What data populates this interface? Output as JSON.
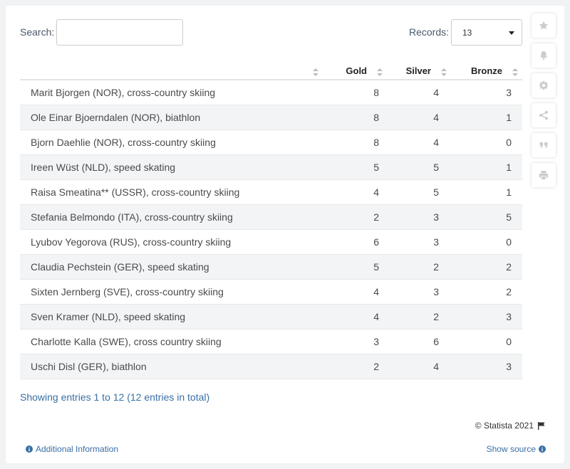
{
  "search": {
    "label": "Search:",
    "value": ""
  },
  "records": {
    "label": "Records:",
    "selected": "13"
  },
  "table": {
    "headers": [
      "",
      "Gold",
      "Silver",
      "Bronze"
    ],
    "rows": [
      [
        "Marit Bjorgen (NOR), cross-country skiing",
        "8",
        "4",
        "3"
      ],
      [
        "Ole Einar Bjoerndalen (NOR), biathlon",
        "8",
        "4",
        "1"
      ],
      [
        "Bjorn Daehlie (NOR), cross-country skiing",
        "8",
        "4",
        "0"
      ],
      [
        "Ireen Wüst (NLD), speed skating",
        "5",
        "5",
        "1"
      ],
      [
        "Raisa Smeatina** (USSR), cross-country skiing",
        "4",
        "5",
        "1"
      ],
      [
        "Stefania Belmondo (ITA), cross-country skiing",
        "2",
        "3",
        "5"
      ],
      [
        "Lyubov Yegorova (RUS), cross-country skiing",
        "6",
        "3",
        "0"
      ],
      [
        "Claudia Pechstein (GER), speed skating",
        "5",
        "2",
        "2"
      ],
      [
        "Sixten Jernberg (SVE), cross-country skiing",
        "4",
        "3",
        "2"
      ],
      [
        "Sven Kramer (NLD), speed skating",
        "4",
        "2",
        "3"
      ],
      [
        "Charlotte Kalla (SWE), cross country skiing",
        "3",
        "6",
        "0"
      ],
      [
        "Uschi Disl (GER), biathlon",
        "2",
        "4",
        "3"
      ]
    ]
  },
  "footer": {
    "entries": "Showing entries 1 to 12 (12 entries in total)",
    "copyright": "© Statista 2021",
    "additional_info": "Additional Information",
    "show_source": "Show source"
  },
  "sidebar": {
    "icons": [
      "star-icon",
      "bell-icon",
      "gear-icon",
      "share-icon",
      "quote-icon",
      "print-icon"
    ]
  },
  "colors": {
    "link": "#3a6fa6",
    "row_alt": "#f2f4f6",
    "icon": "#c9ccd0"
  }
}
